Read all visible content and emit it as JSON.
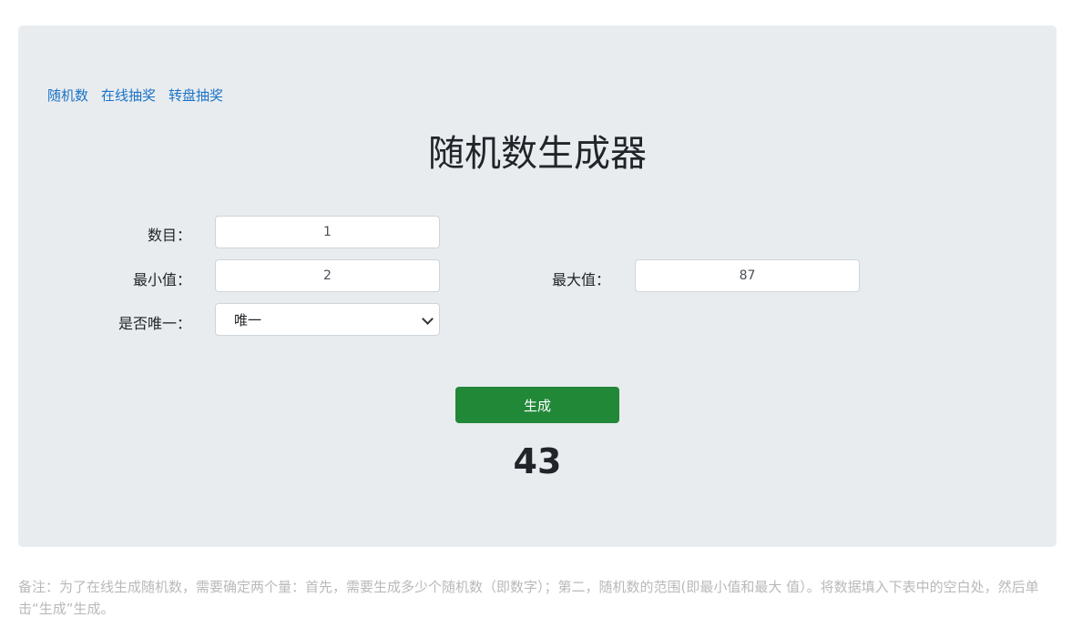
{
  "nav": {
    "items": [
      "随机数",
      "在线抽奖",
      "转盘抽奖"
    ]
  },
  "title": "随机数生成器",
  "form": {
    "count_label": "数目：",
    "count_value": "1",
    "min_label": "最小值：",
    "min_value": "2",
    "max_label": "最大值：",
    "max_value": "87",
    "unique_label": "是否唯一：",
    "unique_selected": "唯一"
  },
  "generate_button": "生成",
  "result": "43",
  "note": "备注：为了在线生成随机数，需要确定两个量：首先，需要生成多少个随机数（即数字）；第二，随机数的范围(即最小值和最大 值）。将数据填入下表中的空白处，然后单击“生成”生成。",
  "colors": {
    "panel_bg": "#e9ecef",
    "link": "#1a73c7",
    "button": "#218838",
    "note_text": "#b9b9b9"
  }
}
